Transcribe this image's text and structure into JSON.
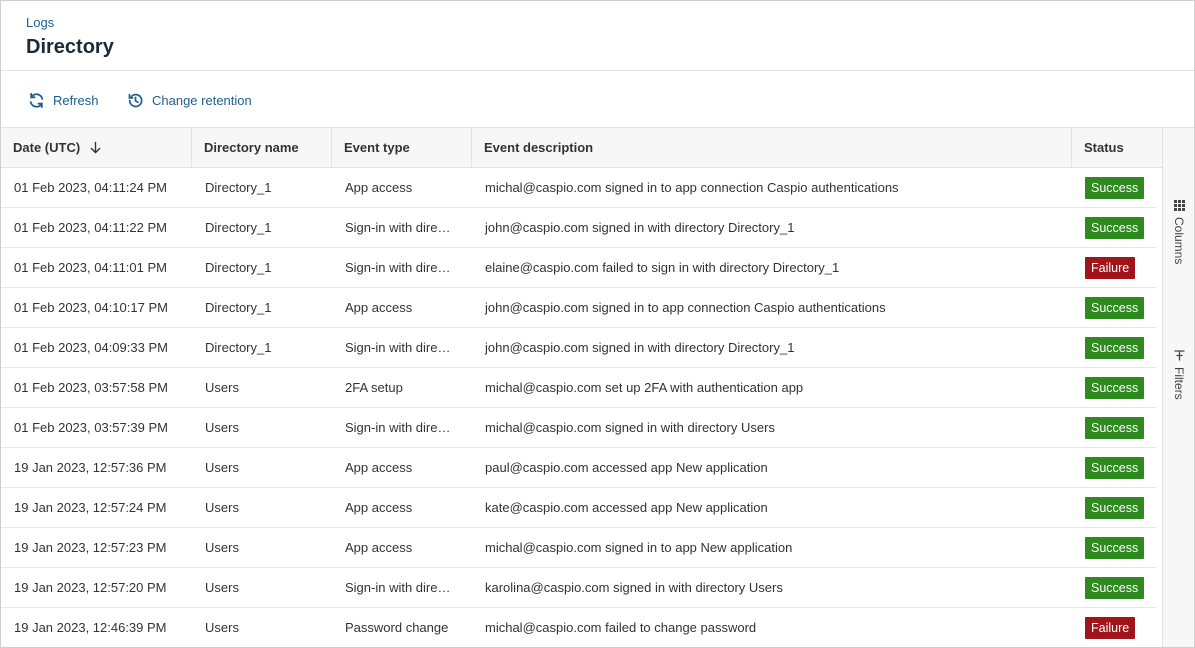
{
  "header": {
    "breadcrumb": "Logs",
    "title": "Directory"
  },
  "toolbar": {
    "refresh_label": "Refresh",
    "retention_label": "Change retention"
  },
  "table": {
    "columns": [
      "Date (UTC)",
      "Directory name",
      "Event type",
      "Event description",
      "Status"
    ],
    "sort_icon": "arrow-down-icon",
    "rows": [
      {
        "date": "01 Feb 2023, 04:11:24 PM",
        "directory": "Directory_1",
        "event_type": "App access",
        "description": "michal@caspio.com signed in to app connection Caspio authentications",
        "status": "Success"
      },
      {
        "date": "01 Feb 2023, 04:11:22 PM",
        "directory": "Directory_1",
        "event_type": "Sign-in with directory",
        "description": "john@caspio.com signed in with directory Directory_1",
        "status": "Success"
      },
      {
        "date": "01 Feb 2023, 04:11:01 PM",
        "directory": "Directory_1",
        "event_type": "Sign-in with directory",
        "description": "elaine@caspio.com failed to sign in with directory Directory_1",
        "status": "Failure"
      },
      {
        "date": "01 Feb 2023, 04:10:17 PM",
        "directory": "Directory_1",
        "event_type": "App access",
        "description": "john@caspio.com signed in to app connection Caspio authentications",
        "status": "Success"
      },
      {
        "date": "01 Feb 2023, 04:09:33 PM",
        "directory": "Directory_1",
        "event_type": "Sign-in with directory",
        "description": "john@caspio.com signed in with directory Directory_1",
        "status": "Success"
      },
      {
        "date": "01 Feb 2023, 03:57:58 PM",
        "directory": "Users",
        "event_type": "2FA setup",
        "description": "michal@caspio.com set up 2FA with authentication app",
        "status": "Success"
      },
      {
        "date": "01 Feb 2023, 03:57:39 PM",
        "directory": "Users",
        "event_type": "Sign-in with directory",
        "description": "michal@caspio.com signed in with directory Users",
        "status": "Success"
      },
      {
        "date": "19 Jan 2023, 12:57:36 PM",
        "directory": "Users",
        "event_type": "App access",
        "description": "paul@caspio.com accessed app New application",
        "status": "Success"
      },
      {
        "date": "19 Jan 2023, 12:57:24 PM",
        "directory": "Users",
        "event_type": "App access",
        "description": "kate@caspio.com accessed app New application",
        "status": "Success"
      },
      {
        "date": "19 Jan 2023, 12:57:23 PM",
        "directory": "Users",
        "event_type": "App access",
        "description": "michal@caspio.com signed in to app New application",
        "status": "Success"
      },
      {
        "date": "19 Jan 2023, 12:57:20 PM",
        "directory": "Users",
        "event_type": "Sign-in with directory",
        "description": "karolina@caspio.com signed in with directory Users",
        "status": "Success"
      },
      {
        "date": "19 Jan 2023, 12:46:39 PM",
        "directory": "Users",
        "event_type": "Password change",
        "description": "michal@caspio.com failed to change password",
        "status": "Failure"
      }
    ]
  },
  "side_panel": {
    "columns_label": "Columns",
    "filters_label": "Filters"
  },
  "colors": {
    "link": "#1f5f8b",
    "success": "#2e8a1e",
    "failure": "#a0151b"
  }
}
